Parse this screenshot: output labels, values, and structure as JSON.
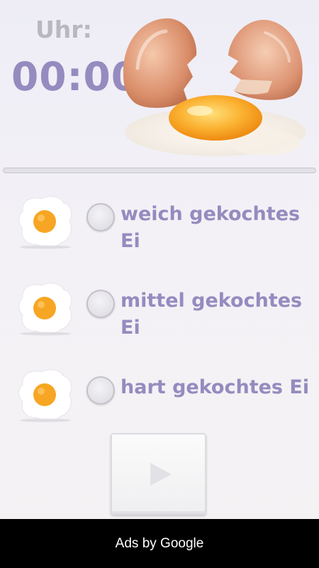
{
  "clock": {
    "label": "Uhr:",
    "time": "00:00"
  },
  "progress": {
    "fraction": 0
  },
  "options": [
    {
      "label": "weich gekochtes Ei",
      "selected": false
    },
    {
      "label": "mittel gekochtes Ei",
      "selected": false
    },
    {
      "label": "hart gekochtes Ei",
      "selected": false
    }
  ],
  "controls": {
    "play_icon": "play-icon"
  },
  "ad": {
    "text": "Ads by Google"
  },
  "colors": {
    "accent": "#958bbf",
    "label_gray": "#b9b7c0",
    "yolk": "#f7a623",
    "ad_background": "#000000"
  }
}
